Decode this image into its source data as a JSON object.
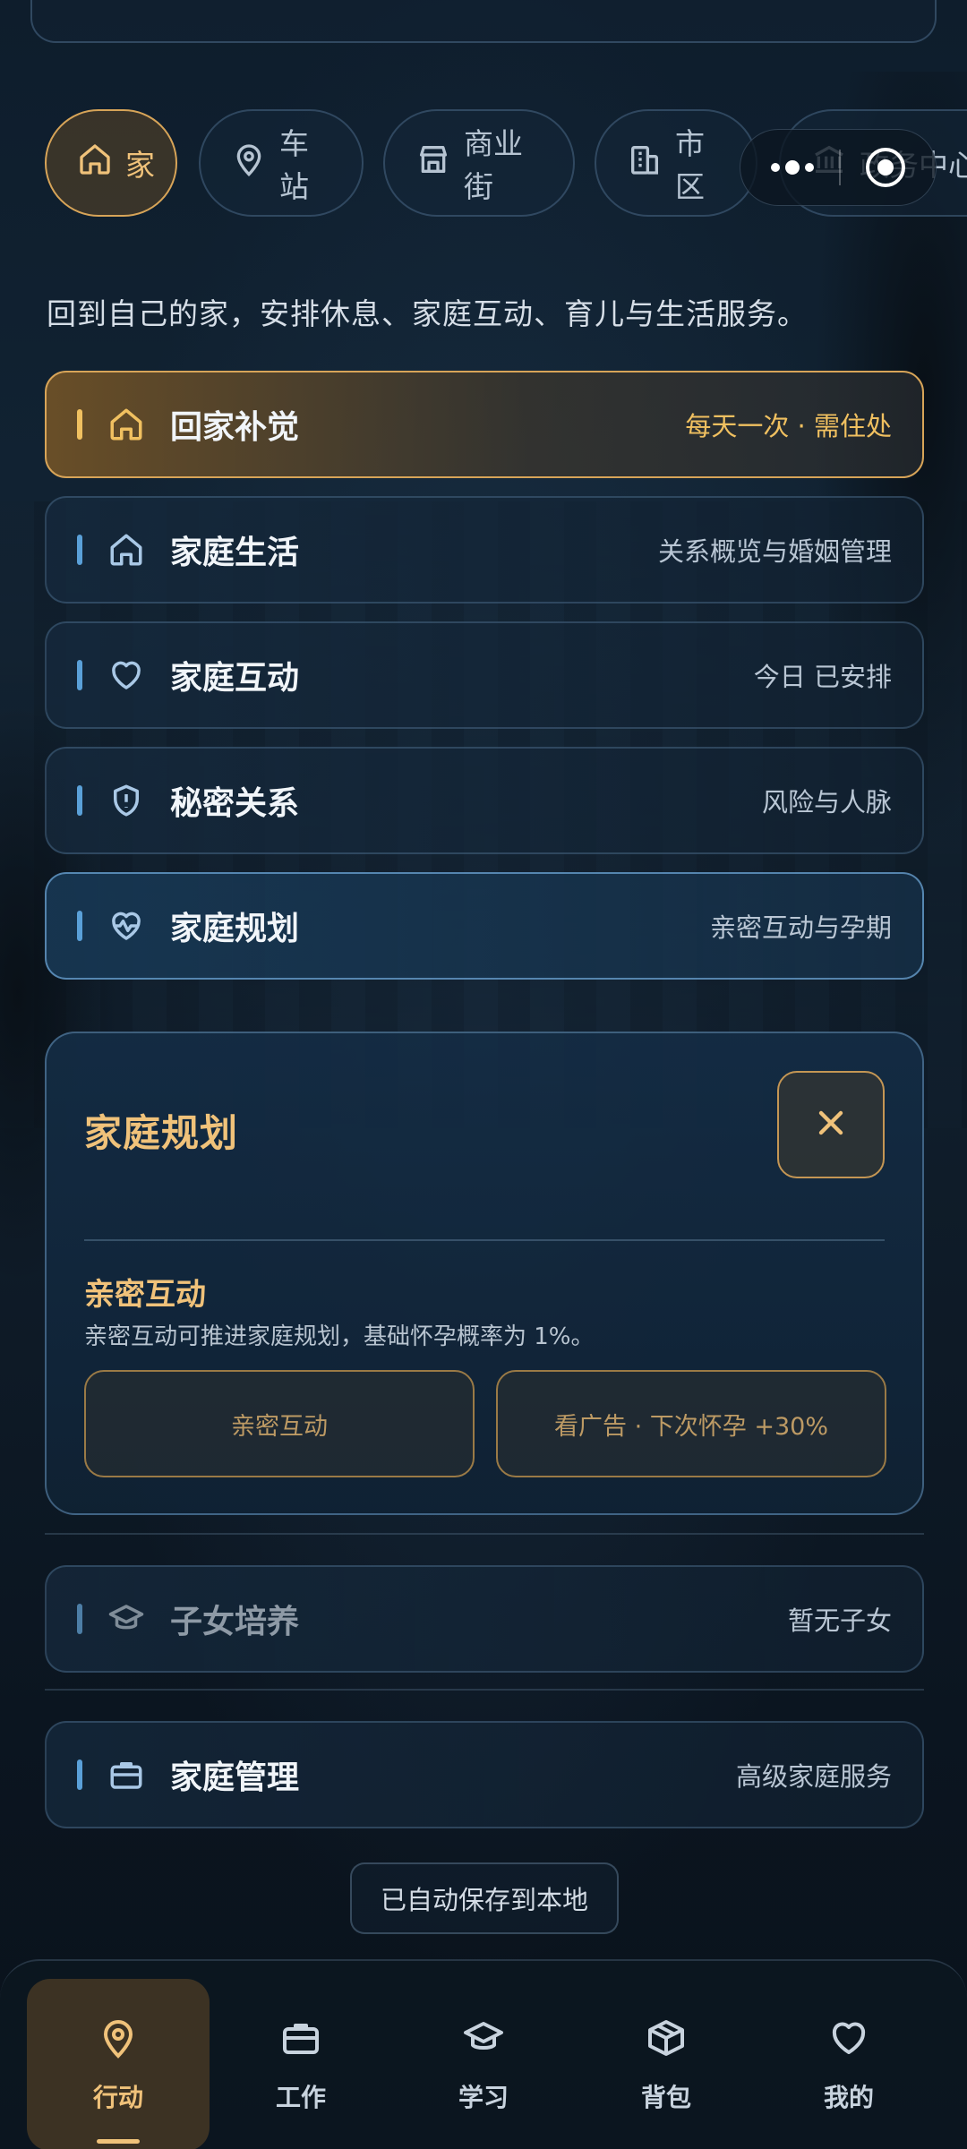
{
  "chips": [
    {
      "label": "家",
      "icon": "home-icon",
      "active": true
    },
    {
      "label": "车站",
      "icon": "map-pin-icon"
    },
    {
      "label": "商业街",
      "icon": "store-icon"
    },
    {
      "label": "市区",
      "icon": "building-icon"
    },
    {
      "label": "政务中心",
      "icon": "bank-icon"
    }
  ],
  "description": "回到自己的家，安排休息、家庭互动、育儿与生活服务。",
  "rows": [
    {
      "title": "回家补觉",
      "meta": "每天一次 · 需住处",
      "icon": "home-icon"
    },
    {
      "title": "家庭生活",
      "meta": "关系概览与婚姻管理",
      "icon": "home-icon"
    },
    {
      "title": "家庭互动",
      "meta": "今日 已安排",
      "icon": "heart-icon"
    },
    {
      "title": "秘密关系",
      "meta": "风险与人脉",
      "icon": "shield-alert-icon"
    },
    {
      "title": "家庭规划",
      "meta": "亲密互动与孕期",
      "icon": "heart-pulse-icon"
    }
  ],
  "panel": {
    "title": "家庭规划",
    "section_title": "亲密互动",
    "section_desc": "亲密互动可推进家庭规划，基础怀孕概率为 1%。",
    "btn_left": "亲密互动",
    "btn_right": "看广告 · 下次怀孕 +30%"
  },
  "rows_after": [
    {
      "title": "子女培养",
      "meta": "暂无子女",
      "icon": "graduation-cap-icon"
    },
    {
      "title": "家庭管理",
      "meta": "高级家庭服务",
      "icon": "briefcase-icon"
    }
  ],
  "save_status": "已自动保存到本地",
  "tabs": [
    {
      "label": "行动",
      "icon": "map-pin-icon",
      "active": true
    },
    {
      "label": "工作",
      "icon": "briefcase-icon"
    },
    {
      "label": "学习",
      "icon": "graduation-cap-icon"
    },
    {
      "label": "背包",
      "icon": "box-icon"
    },
    {
      "label": "我的",
      "icon": "heart-icon"
    }
  ],
  "colors": {
    "accent_gold": "#f0c27a",
    "accent_blue": "#5aa0d8",
    "background": "#0b1622"
  }
}
